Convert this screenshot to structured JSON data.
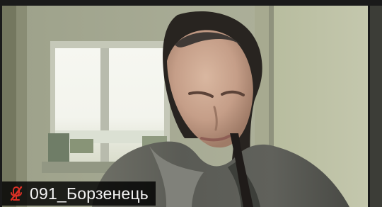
{
  "participant": {
    "name": "091_Борзенець",
    "mic_status": "muted"
  },
  "icons": {
    "mic": "microphone-muted-icon"
  },
  "colors": {
    "muted_icon": "#d93025",
    "label_background": "#111111",
    "label_text": "#f2f2f2",
    "tile_border": "#1a1a1a"
  }
}
